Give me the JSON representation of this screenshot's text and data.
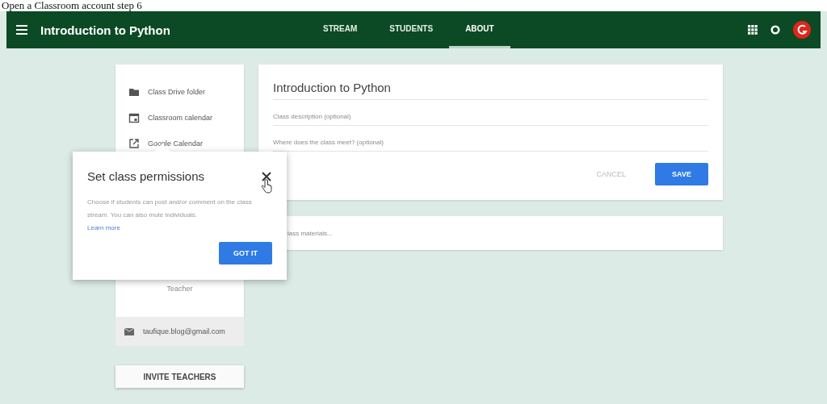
{
  "caption": "Open a Classroom account step 6",
  "header": {
    "title": "Introduction to Python",
    "tabs": [
      {
        "label": "STREAM",
        "selected": false
      },
      {
        "label": "STUDENTS",
        "selected": false
      },
      {
        "label": "ABOUT",
        "selected": true
      }
    ]
  },
  "sidebar": {
    "links": [
      {
        "kind": "folder",
        "label": "Class Drive folder"
      },
      {
        "kind": "calendar",
        "label": "Classroom calendar"
      },
      {
        "kind": "external",
        "label": "Google Calendar"
      }
    ],
    "role": "Teacher",
    "email": "taufique.blog@gmail.com",
    "invite_button": "INVITE TEACHERS"
  },
  "about": {
    "title_value": "Introduction to Python",
    "description_placeholder": "Class description (optional)",
    "room_placeholder": "Where does the class meet? (optional)",
    "cancel": "CANCEL",
    "save": "SAVE"
  },
  "materials": {
    "placeholder": "lass materials..."
  },
  "popup": {
    "title": "Set class permissions",
    "body": "Choose if students can post and/or comment on the class stream. You can also mute individuals.",
    "link": "Learn more",
    "button": "GOT IT"
  }
}
